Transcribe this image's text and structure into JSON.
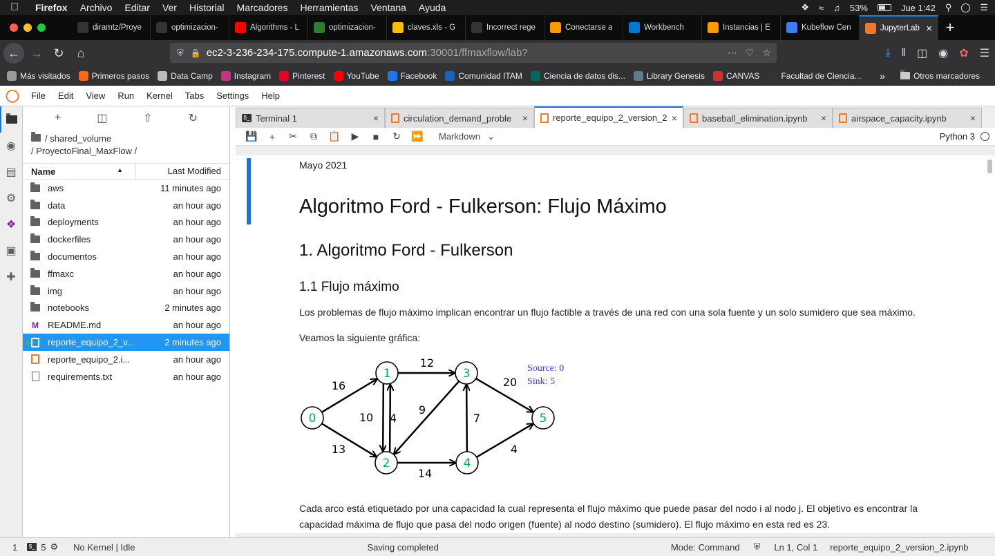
{
  "mac": {
    "app": "Firefox",
    "menus": [
      "Archivo",
      "Editar",
      "Ver",
      "Historial",
      "Marcadores",
      "Herramientas",
      "Ventana",
      "Ayuda"
    ],
    "battery": "53%",
    "clock": "Jue 1:42"
  },
  "browser": {
    "tabs": [
      {
        "title": "diramtz/Proye",
        "icon": "github-icon",
        "color": "#333333"
      },
      {
        "title": "optimizacion-",
        "icon": "github-icon",
        "color": "#333333"
      },
      {
        "title": "Algorithms - L",
        "icon": "youtube-icon",
        "color": "#ff0000"
      },
      {
        "title": "optimizacion-",
        "icon": "chart-icon",
        "color": "#2e7d32"
      },
      {
        "title": "claves.xls - G",
        "icon": "drive-icon",
        "color": "#fbbc04"
      },
      {
        "title": "Incorrect rege",
        "icon": "github-icon",
        "color": "#333333"
      },
      {
        "title": "Conectarse a",
        "icon": "aws-icon",
        "color": "#ff9900"
      },
      {
        "title": "Workbench",
        "icon": "vscode-icon",
        "color": "#0078d4"
      },
      {
        "title": "Instancias | E",
        "icon": "aws-icon",
        "color": "#ff9900"
      },
      {
        "title": "Kubeflow Cen",
        "icon": "kubeflow-icon",
        "color": "#4279f4"
      },
      {
        "title": "JupyterLab",
        "icon": "jupyter-icon",
        "color": "#f37726",
        "active": true
      }
    ],
    "url_host": "ec2-3-236-234-175.compute-1.amazonaws.com",
    "url_rest": ":30001/ffmaxflow/lab?",
    "bookmarks": [
      {
        "label": "Más visitados",
        "color": "#999999"
      },
      {
        "label": "Primeros pasos",
        "color": "#ff6611"
      },
      {
        "label": "Data Camp",
        "color": "#bbbbbb"
      },
      {
        "label": "Instagram",
        "color": "#c13584"
      },
      {
        "label": "Pinterest",
        "color": "#e60023"
      },
      {
        "label": "YouTube",
        "color": "#ff0000"
      },
      {
        "label": "Facebook",
        "color": "#1877f2"
      },
      {
        "label": "Comunidad ITAM",
        "color": "#1565c0"
      },
      {
        "label": "Ciencia de datos dis...",
        "color": "#00695c"
      },
      {
        "label": "Library Genesis",
        "color": "#607d8b"
      },
      {
        "label": "CANVAS",
        "color": "#d32f2f"
      },
      {
        "label": "Facultad de Ciencia...",
        "color": "#333333"
      }
    ],
    "other_bookmarks": "Otros marcadores"
  },
  "jupyter": {
    "menus": [
      "File",
      "Edit",
      "View",
      "Run",
      "Kernel",
      "Tabs",
      "Settings",
      "Help"
    ],
    "breadcrumb_line1": "/ shared_volume",
    "breadcrumb_line2": "/ ProyectoFinal_MaxFlow /",
    "col_name": "Name",
    "col_modified": "Last Modified",
    "files": [
      {
        "name": "aws",
        "modified": "11 minutes ago",
        "type": "folder"
      },
      {
        "name": "data",
        "modified": "an hour ago",
        "type": "folder"
      },
      {
        "name": "deployments",
        "modified": "an hour ago",
        "type": "folder"
      },
      {
        "name": "dockerfiles",
        "modified": "an hour ago",
        "type": "folder"
      },
      {
        "name": "documentos",
        "modified": "an hour ago",
        "type": "folder"
      },
      {
        "name": "ffmaxc",
        "modified": "an hour ago",
        "type": "folder"
      },
      {
        "name": "img",
        "modified": "an hour ago",
        "type": "folder"
      },
      {
        "name": "notebooks",
        "modified": "2 minutes ago",
        "type": "folder"
      },
      {
        "name": "README.md",
        "modified": "an hour ago",
        "type": "md"
      },
      {
        "name": "reporte_equipo_2_v...",
        "modified": "2 minutes ago",
        "type": "notebook",
        "selected": true
      },
      {
        "name": "reporte_equipo_2.i...",
        "modified": "an hour ago",
        "type": "notebook"
      },
      {
        "name": "requirements.txt",
        "modified": "an hour ago",
        "type": "txt"
      }
    ],
    "doc_tabs": [
      {
        "title": "Terminal 1",
        "type": "terminal"
      },
      {
        "title": "circulation_demand_proble",
        "type": "notebook"
      },
      {
        "title": "reporte_equipo_2_version_2",
        "type": "notebook",
        "active": true
      },
      {
        "title": "baseball_elimination.ipynb",
        "type": "notebook"
      },
      {
        "title": "airspace_capacity.ipynb",
        "type": "notebook"
      }
    ],
    "cell_type": "Markdown",
    "kernel": "Python 3"
  },
  "notebook": {
    "date": "Mayo 2021",
    "h1": "Algoritmo Ford - Fulkerson: Flujo Máximo",
    "h2": "1. Algoritmo Ford - Fulkerson",
    "h3": "1.1 Flujo máximo",
    "p1": "Los problemas de flujo máximo implican encontrar un flujo factible a través de una red con una sola fuente y un solo sumidero que sea máximo.",
    "p2": "Veamos la siguiente gráfica:",
    "p3": "Cada arco está etiquetado por una capacidad la cual representa el flujo máximo que puede pasar del nodo i al nodo j. El objetivo es encontrar la capacidad máxima de flujo que pasa del nodo origen (fuente) al nodo destino (sumidero). El flujo máximo en esta red es 23."
  },
  "graph": {
    "source_label": "Source: 0",
    "sink_label": "Sink: 5",
    "nodes": [
      "0",
      "1",
      "2",
      "3",
      "4",
      "5"
    ],
    "edges": [
      {
        "from": "0",
        "to": "1",
        "capacity": "16"
      },
      {
        "from": "0",
        "to": "2",
        "capacity": "13"
      },
      {
        "from": "1",
        "to": "3",
        "capacity": "12"
      },
      {
        "from": "1",
        "to": "2",
        "capacity": "10"
      },
      {
        "from": "2",
        "to": "1",
        "capacity": "4"
      },
      {
        "from": "3",
        "to": "2",
        "capacity": "9"
      },
      {
        "from": "3",
        "to": "5",
        "capacity": "20"
      },
      {
        "from": "2",
        "to": "4",
        "capacity": "14"
      },
      {
        "from": "4",
        "to": "3",
        "capacity": "7"
      },
      {
        "from": "4",
        "to": "5",
        "capacity": "4"
      }
    ]
  },
  "status": {
    "left_num": "1",
    "terminals": "5",
    "kernel_status": "No Kernel | Idle",
    "saving": "Saving completed",
    "mode": "Mode: Command",
    "position": "Ln 1, Col 1",
    "filename": "reporte_equipo_2_version_2.ipynb"
  }
}
